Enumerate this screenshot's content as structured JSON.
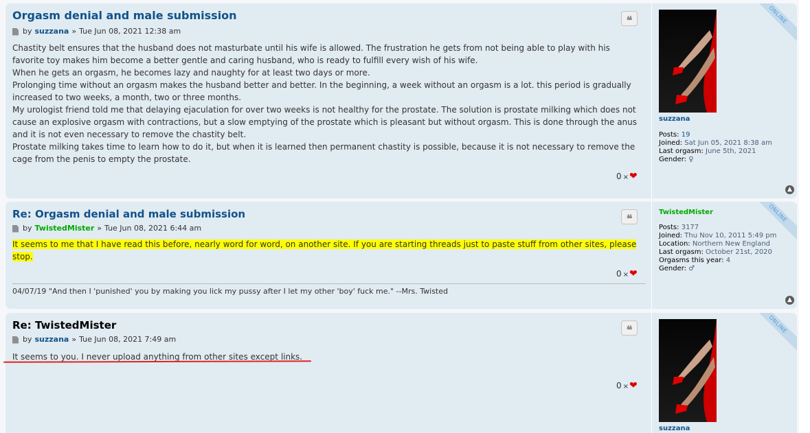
{
  "posts": [
    {
      "title": "Orgasm denial and male submission",
      "by": "by",
      "author": "suzzana",
      "date": "Tue Jun 08, 2021 12:38 am",
      "content": [
        "Chastity belt ensures that the husband does not masturbate until his wife is allowed. The frustration he gets from not being able to play with his favorite toy makes him become a better gentle and caring husband, who is ready to fulfill every wish of his wife.",
        "When he gets an orgasm, he becomes lazy and naughty for at least two days or more.",
        "Prolonging time without an orgasm makes the husband better and better. In the beginning, a week without an orgasm is a lot. this period is gradually increased to two weeks, a month, two or three months.",
        "My urologist friend told me that delaying ejaculation for over two weeks is not healthy for the prostate. The solution is prostate milking which does not cause an explosive orgasm with contractions, but a slow emptying of the prostate which is pleasant but without orgasm. This is done through the anus and it is not even necessary to remove the chastity belt.",
        "Prostate milking takes time to learn how to do it, but when it is learned then permanent chastity is possible, because it is not necessary to remove the cage from the penis to empty the prostate."
      ],
      "likes": "0",
      "profile": {
        "name": "suzzana",
        "status": "ONLINE",
        "posts_label": "Posts:",
        "posts": "19",
        "joined_label": "Joined:",
        "joined": "Sat Jun 05, 2021 8:38 am",
        "orgasm_label": "Last orgasm:",
        "orgasm": "June 5th, 2021",
        "gender_label": "Gender:",
        "gender": "♀"
      }
    },
    {
      "title": "Re: Orgasm denial and male submission",
      "by": "by",
      "author": "TwistedMister",
      "date": "Tue Jun 08, 2021 6:44 am",
      "content": "It seems to me that I have read this before, nearly word for word, on another site. If you are starting threads just to paste stuff from other sites, please stop.",
      "likes": "0",
      "signature": "04/07/19 \"And then I 'punished' you by making you lick my pussy after I let my other 'boy' fuck me.\" --Mrs. Twisted",
      "profile": {
        "name": "TwistedMister",
        "status": "ONLINE",
        "posts_label": "Posts:",
        "posts": "3177",
        "joined_label": "Joined:",
        "joined": "Thu Nov 10, 2011 5:49 pm",
        "location_label": "Location:",
        "location": "Northern New England",
        "orgasm_label": "Last orgasm:",
        "orgasm": "October 21st, 2020",
        "year_label": "Orgasms this year:",
        "year": "4",
        "gender_label": "Gender:",
        "gender": "♂"
      }
    },
    {
      "title": "Re: TwistedMister",
      "by": "by",
      "author": "suzzana",
      "date": "Tue Jun 08, 2021 7:49 am",
      "content": "It seems to you. I never upload anything from other sites except links.",
      "likes": "0",
      "profile": {
        "name": "suzzana",
        "status": "ONLINE"
      }
    }
  ],
  "ui": {
    "raquo": "»",
    "times": "×",
    "heart": "❤",
    "quote_glyph": "❝",
    "top_glyph": "▲"
  },
  "colors": {
    "post_bg": "#e1ebf2",
    "link": "#105289",
    "author_green": "#00aa00",
    "highlight": "#ffff00",
    "heart": "#e00000"
  }
}
